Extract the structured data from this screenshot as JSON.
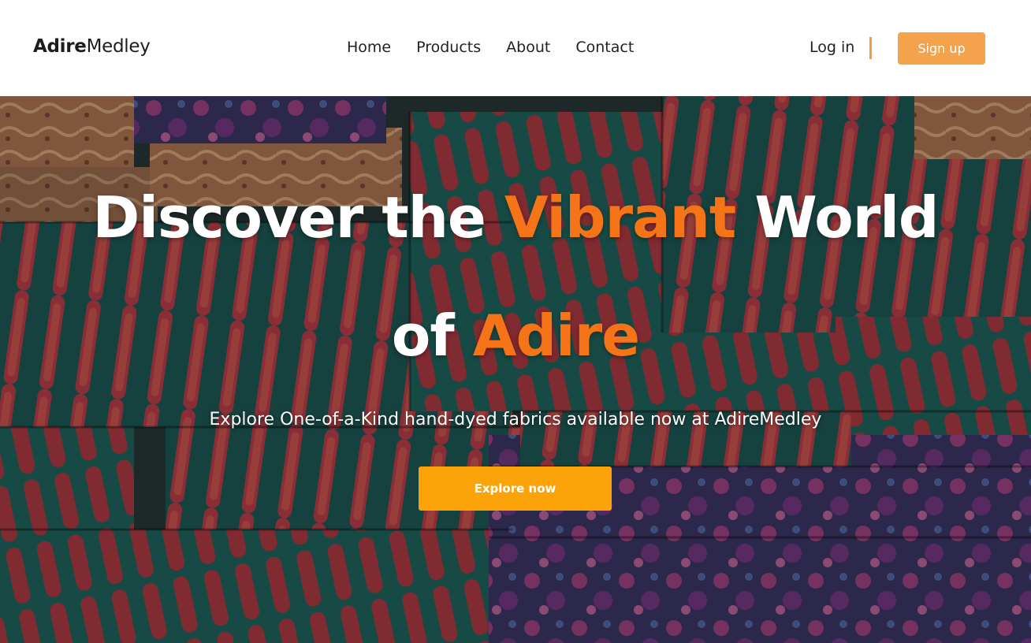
{
  "brand": {
    "bold": "Adire",
    "light": "Medley"
  },
  "nav": {
    "items": [
      {
        "label": "Home"
      },
      {
        "label": "Products"
      },
      {
        "label": "About"
      },
      {
        "label": "Contact"
      }
    ]
  },
  "auth": {
    "login_label": "Log in",
    "signup_label": "Sign up"
  },
  "hero": {
    "line1_pre": "Discover the ",
    "line1_accent": "Vibrant",
    "line1_post": " World",
    "line2_pre": "of ",
    "line2_accent": "Adire",
    "subtitle": "Explore One-of-a-Kind hand-dyed fabrics available now at AdireMedley",
    "cta_label": "Explore now"
  },
  "colors": {
    "accent": "#f47417",
    "signup_bg": "#f4a24b",
    "cta_bg": "#fca30a",
    "divider": "#f39a3c"
  }
}
